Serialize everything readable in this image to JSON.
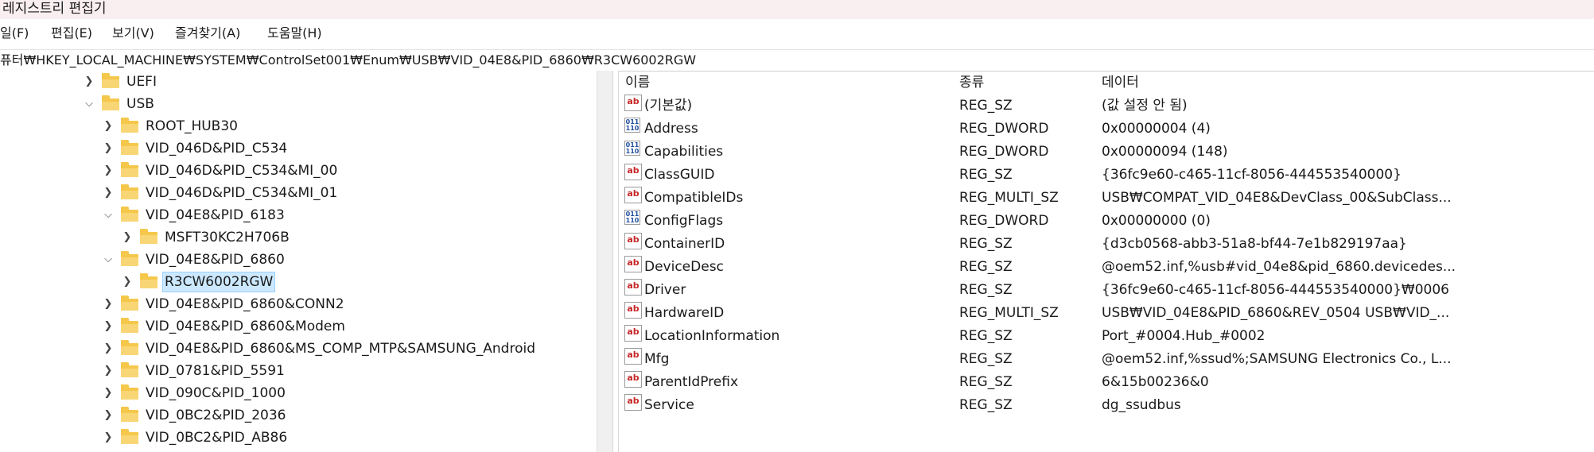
{
  "window": {
    "title": "레지스트리 편집기"
  },
  "menu": [
    "일(F)",
    "편집(E)",
    "보기(V)",
    "즐겨찾기(A)",
    "도움말(H)"
  ],
  "address": "퓨터₩HKEY_LOCAL_MACHINE₩SYSTEM₩ControlSet001₩Enum₩USB₩VID_04E8&PID_6860₩R3CW6002RGW",
  "tree": [
    {
      "label": "UEFI",
      "expanded": false
    },
    {
      "label": "USB",
      "expanded": true
    },
    {
      "label": "ROOT_HUB30",
      "expanded": false
    },
    {
      "label": "VID_046D&PID_C534",
      "expanded": false
    },
    {
      "label": "VID_046D&PID_C534&MI_00",
      "expanded": false
    },
    {
      "label": "VID_046D&PID_C534&MI_01",
      "expanded": false
    },
    {
      "label": "VID_04E8&PID_6183",
      "expanded": true
    },
    {
      "label": "MSFT30KC2H706B",
      "expanded": false
    },
    {
      "label": "VID_04E8&PID_6860",
      "expanded": true
    },
    {
      "label": "R3CW6002RGW",
      "expanded": false,
      "selected": true
    },
    {
      "label": "VID_04E8&PID_6860&CONN2",
      "expanded": false
    },
    {
      "label": "VID_04E8&PID_6860&Modem",
      "expanded": false
    },
    {
      "label": "VID_04E8&PID_6860&MS_COMP_MTP&SAMSUNG_Android",
      "expanded": false
    },
    {
      "label": "VID_0781&PID_5591",
      "expanded": false
    },
    {
      "label": "VID_090C&PID_1000",
      "expanded": false
    },
    {
      "label": "VID_0BC2&PID_2036",
      "expanded": false
    },
    {
      "label": "VID_0BC2&PID_AB86",
      "expanded": false
    }
  ],
  "columns": {
    "name": "이름",
    "type": "종류",
    "data": "데이터"
  },
  "values": [
    {
      "icon": "string-value-icon",
      "name": "(기본값)",
      "type": "REG_SZ",
      "data": "(값 설정 안 됨)"
    },
    {
      "icon": "binary-value-icon",
      "name": "Address",
      "type": "REG_DWORD",
      "data": "0x00000004 (4)"
    },
    {
      "icon": "binary-value-icon",
      "name": "Capabilities",
      "type": "REG_DWORD",
      "data": "0x00000094 (148)"
    },
    {
      "icon": "string-value-icon",
      "name": "ClassGUID",
      "type": "REG_SZ",
      "data": "{36fc9e60-c465-11cf-8056-444553540000}"
    },
    {
      "icon": "string-value-icon",
      "name": "CompatibleIDs",
      "type": "REG_MULTI_SZ",
      "data": "USB₩COMPAT_VID_04E8&DevClass_00&SubClass..."
    },
    {
      "icon": "binary-value-icon",
      "name": "ConfigFlags",
      "type": "REG_DWORD",
      "data": "0x00000000 (0)"
    },
    {
      "icon": "string-value-icon",
      "name": "ContainerID",
      "type": "REG_SZ",
      "data": "{d3cb0568-abb3-51a8-bf44-7e1b829197aa}"
    },
    {
      "icon": "string-value-icon",
      "name": "DeviceDesc",
      "type": "REG_SZ",
      "data": "@oem52.inf,%usb#vid_04e8&pid_6860.devicedes..."
    },
    {
      "icon": "string-value-icon",
      "name": "Driver",
      "type": "REG_SZ",
      "data": "{36fc9e60-c465-11cf-8056-444553540000}₩0006"
    },
    {
      "icon": "string-value-icon",
      "name": "HardwareID",
      "type": "REG_MULTI_SZ",
      "data": "USB₩VID_04E8&PID_6860&REV_0504 USB₩VID_..."
    },
    {
      "icon": "string-value-icon",
      "name": "LocationInformation",
      "type": "REG_SZ",
      "data": "Port_#0004.Hub_#0002"
    },
    {
      "icon": "string-value-icon",
      "name": "Mfg",
      "type": "REG_SZ",
      "data": "@oem52.inf,%ssud%;SAMSUNG Electronics Co., L..."
    },
    {
      "icon": "string-value-icon",
      "name": "ParentIdPrefix",
      "type": "REG_SZ",
      "data": "6&15b00236&0"
    },
    {
      "icon": "string-value-icon",
      "name": "Service",
      "type": "REG_SZ",
      "data": "dg_ssudbus"
    }
  ]
}
